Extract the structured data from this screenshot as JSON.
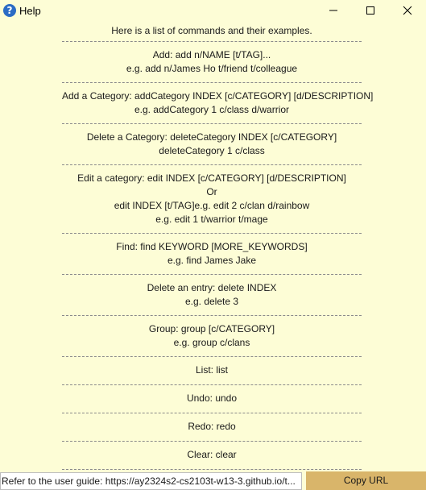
{
  "window": {
    "title": "Help",
    "app_icon": "help-question-icon"
  },
  "header_text": "Here is a list of commands and their examples.",
  "commands": [
    [
      "Add: add n/NAME [t/TAG]...",
      "e.g. add n/James Ho t/friend t/colleague"
    ],
    [
      "Add a Category: addCategory INDEX [c/CATEGORY] [d/DESCRIPTION]",
      "e.g. addCategory 1 c/class d/warrior"
    ],
    [
      "Delete a Category: deleteCategory INDEX [c/CATEGORY]",
      "deleteCategory 1 c/class"
    ],
    [
      "Edit a category: edit INDEX [c/CATEGORY] [d/DESCRIPTION]",
      "Or",
      "edit INDEX [t/TAG]e.g. edit 2 c/clan d/rainbow",
      "e.g. edit 1 t/warrior t/mage"
    ],
    [
      "Find: find KEYWORD [MORE_KEYWORDS]",
      "e.g. find James Jake"
    ],
    [
      "Delete an entry: delete INDEX",
      "e.g. delete 3"
    ],
    [
      "Group: group [c/CATEGORY]",
      "e.g. group c/clans"
    ],
    [
      "List: list"
    ],
    [
      "Undo: undo"
    ],
    [
      "Redo: redo"
    ],
    [
      "Clear: clear"
    ]
  ],
  "footer": {
    "url_text": "Refer to the user guide: https://ay2324s2-cs2103t-w13-3.github.io/t...",
    "copy_button": "Copy URL"
  },
  "colors": {
    "background": "#fdfdd6",
    "button": "#d9b56a",
    "icon": "#2b6cc4"
  }
}
